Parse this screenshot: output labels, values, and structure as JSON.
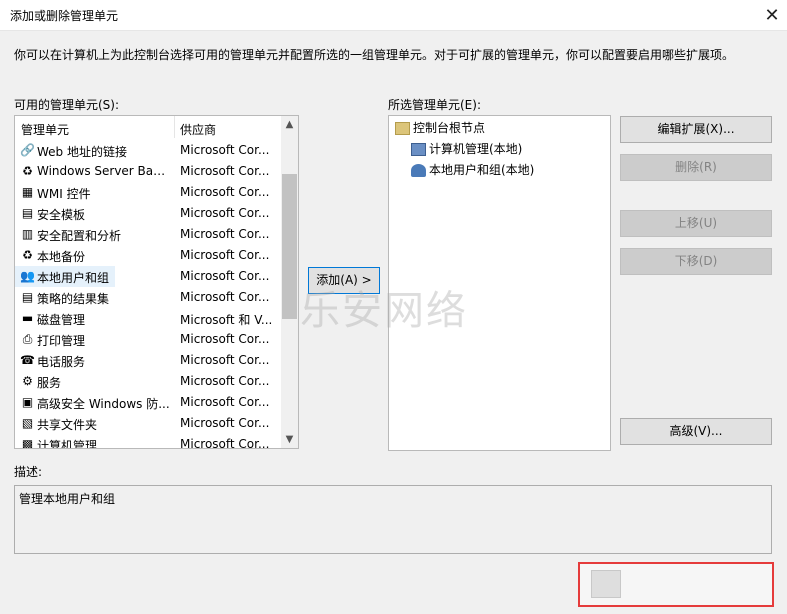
{
  "window": {
    "title": "添加或删除管理单元",
    "close_glyph": "✕"
  },
  "intro": "你可以在计算机上为此控制台选择可用的管理单元并配置所选的一组管理单元。对于可扩展的管理单元，你可以配置要启用哪些扩展项。",
  "available": {
    "label": "可用的管理单元(S):",
    "col_name": "管理单元",
    "col_vendor": "供应商",
    "rows": [
      {
        "icon": "web-link-icon",
        "glyph": "🔗",
        "name": "Web 地址的链接",
        "vendor": "Microsoft Cor..."
      },
      {
        "icon": "server-backup-icon",
        "glyph": "♻",
        "name": "Windows Server Bac...",
        "vendor": "Microsoft Cor..."
      },
      {
        "icon": "wmi-control-icon",
        "glyph": "▦",
        "name": "WMI 控件",
        "vendor": "Microsoft Cor..."
      },
      {
        "icon": "security-template-icon",
        "glyph": "▤",
        "name": "安全模板",
        "vendor": "Microsoft Cor..."
      },
      {
        "icon": "security-config-icon",
        "glyph": "▥",
        "name": "安全配置和分析",
        "vendor": "Microsoft Cor..."
      },
      {
        "icon": "local-backup-icon",
        "glyph": "♻",
        "name": "本地备份",
        "vendor": "Microsoft Cor..."
      },
      {
        "icon": "local-users-icon",
        "glyph": "👥",
        "name": "本地用户和组",
        "vendor": "Microsoft Cor..."
      },
      {
        "icon": "policy-result-icon",
        "glyph": "▤",
        "name": "策略的结果集",
        "vendor": "Microsoft Cor..."
      },
      {
        "icon": "disk-management-icon",
        "glyph": "▬",
        "name": "磁盘管理",
        "vendor": "Microsoft 和 V..."
      },
      {
        "icon": "print-management-icon",
        "glyph": "⎙",
        "name": "打印管理",
        "vendor": "Microsoft Cor..."
      },
      {
        "icon": "telephony-icon",
        "glyph": "☎",
        "name": "电话服务",
        "vendor": "Microsoft Cor..."
      },
      {
        "icon": "services-icon",
        "glyph": "⚙",
        "name": "服务",
        "vendor": "Microsoft Cor..."
      },
      {
        "icon": "firewall-icon",
        "glyph": "▣",
        "name": "高级安全 Windows 防...",
        "vendor": "Microsoft Cor..."
      },
      {
        "icon": "shared-folders-icon",
        "glyph": "▧",
        "name": "共享文件夹",
        "vendor": "Microsoft Cor..."
      },
      {
        "icon": "computer-management-icon",
        "glyph": "▩",
        "name": "计算机管理",
        "vendor": "Microsoft Cor..."
      }
    ],
    "selected_index": 6
  },
  "add_button": "添加(A) >",
  "selected": {
    "label": "所选管理单元(E):",
    "root": "控制台根节点",
    "children": [
      "计算机管理(本地)",
      "本地用户和组(本地)"
    ]
  },
  "buttons": {
    "edit_extensions": "编辑扩展(X)...",
    "remove": "删除(R)",
    "move_up": "上移(U)",
    "move_down": "下移(D)",
    "advanced": "高级(V)..."
  },
  "description": {
    "label": "描述:",
    "text": "管理本地用户和组"
  },
  "watermark": "乐安网络"
}
